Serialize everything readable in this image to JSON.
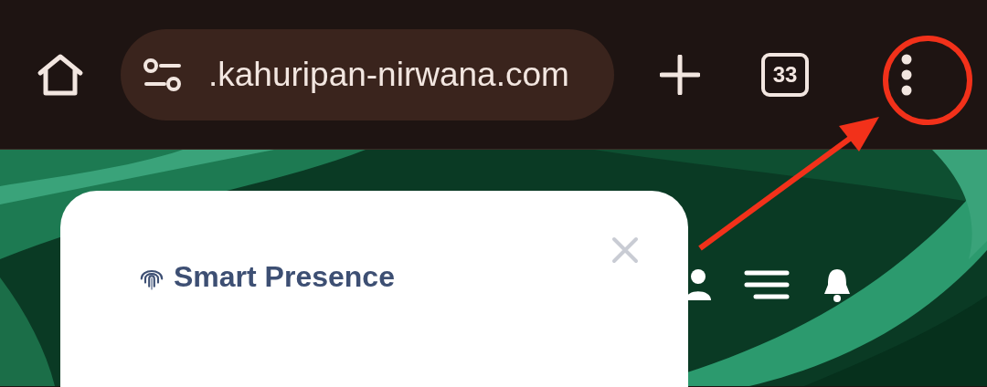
{
  "browser": {
    "url": ".kahuripan-nirwana.com",
    "tab_count": "33"
  },
  "card": {
    "title": "Smart Presence"
  }
}
